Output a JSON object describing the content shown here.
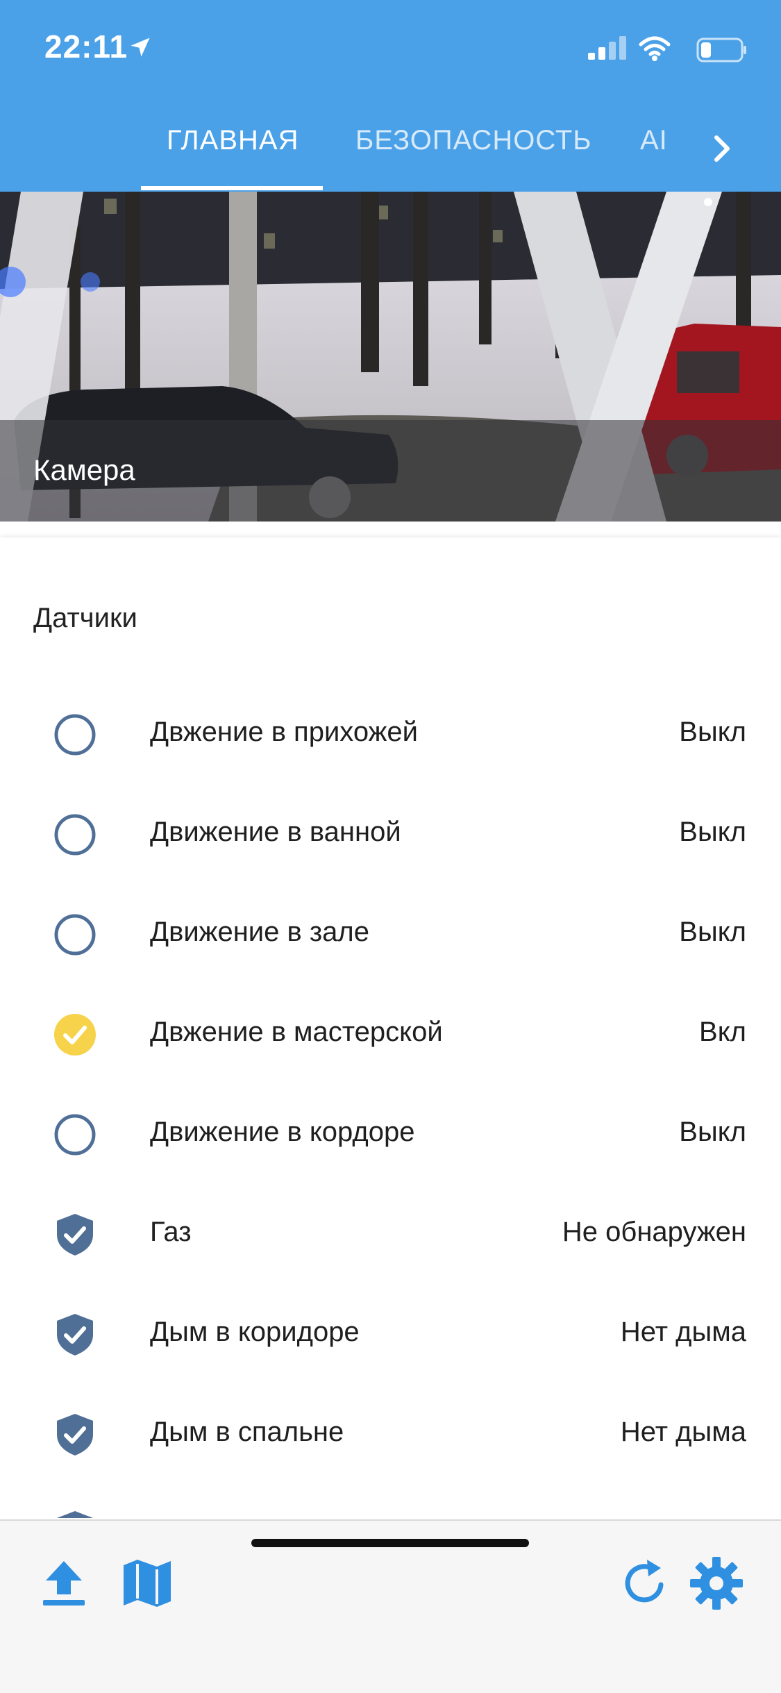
{
  "status_bar": {
    "time": "22:11"
  },
  "tabs": {
    "items": [
      {
        "label": "ГЛАВНАЯ"
      },
      {
        "label": "БЕЗОПАСНОСТЬ"
      },
      {
        "label": "AI"
      }
    ],
    "next_icon": "chevron-right-icon"
  },
  "camera": {
    "title": "Камера"
  },
  "sensors": {
    "title": "Датчики",
    "items": [
      {
        "label": "Двжение в прихожей",
        "value": "Выкл",
        "icon": "circle-outline-icon"
      },
      {
        "label": "Движение в ванной",
        "value": "Выкл",
        "icon": "circle-outline-icon"
      },
      {
        "label": "Движение в зале",
        "value": "Выкл",
        "icon": "circle-outline-icon"
      },
      {
        "label": "Двжение в мастерской",
        "value": "Вкл",
        "icon": "check-circle-icon"
      },
      {
        "label": "Движение в кордоре",
        "value": "Выкл",
        "icon": "circle-outline-icon"
      },
      {
        "label": "Газ",
        "value": "Не обнаружен",
        "icon": "shield-check-icon"
      },
      {
        "label": "Дым в коридоре",
        "value": "Нет дыма",
        "icon": "shield-check-icon"
      },
      {
        "label": "Дым в спальне",
        "value": "Нет дыма",
        "icon": "shield-check-icon"
      }
    ]
  },
  "bottom_bar": {
    "icons": [
      "upload-icon",
      "map-icon",
      "refresh-icon",
      "gear-icon"
    ]
  },
  "colors": {
    "accent": "#4ba1e8",
    "icon_outline": "#4f6f96",
    "active_yellow": "#f6d34a",
    "bottom_icons": "#2f8fe0"
  }
}
